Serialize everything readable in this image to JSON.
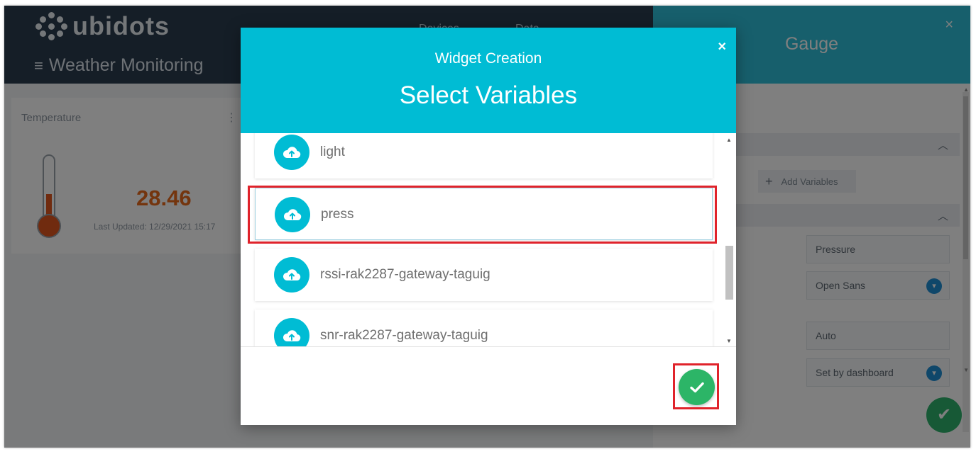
{
  "app": {
    "brand": "ubidots",
    "nav": [
      {
        "label": "Devices ⌄"
      },
      {
        "label": "Data ⌄"
      }
    ],
    "dashboard_title": "Weather Monitoring",
    "menu_glyph": "≡"
  },
  "widget": {
    "title": "Temperature",
    "menu_glyph": "⋮",
    "value": "28.46",
    "last_updated": "Last Updated: 12/29/2021 15:17"
  },
  "side_panel": {
    "title": "Gauge",
    "close_glyph": "×",
    "add_variables_label": "Add Variables",
    "fields": [
      {
        "value": "Pressure"
      },
      {
        "value": "Open Sans"
      },
      {
        "value": "Auto"
      },
      {
        "value": "Set by dashboard"
      }
    ],
    "confirm_glyph": "✔"
  },
  "modal": {
    "subtitle": "Widget Creation",
    "title": "Select Variables",
    "close_glyph": "×",
    "variables": [
      {
        "label": "light",
        "icon": "cloud-upload-icon"
      },
      {
        "label": "press",
        "icon": "cloud-upload-icon",
        "selected": true
      },
      {
        "label": "rssi-rak2287-gateway-taguig",
        "icon": "cloud-upload-icon"
      },
      {
        "label": "snr-rak2287-gateway-taguig",
        "icon": "cloud-upload-icon"
      }
    ],
    "confirm_icon": "check-icon"
  },
  "colors": {
    "modal_header": "#00bcd4",
    "confirm": "#2cb567",
    "highlight": "#e0232b",
    "topbar": "#2b3c4e",
    "side_header": "#2fbfd8"
  }
}
